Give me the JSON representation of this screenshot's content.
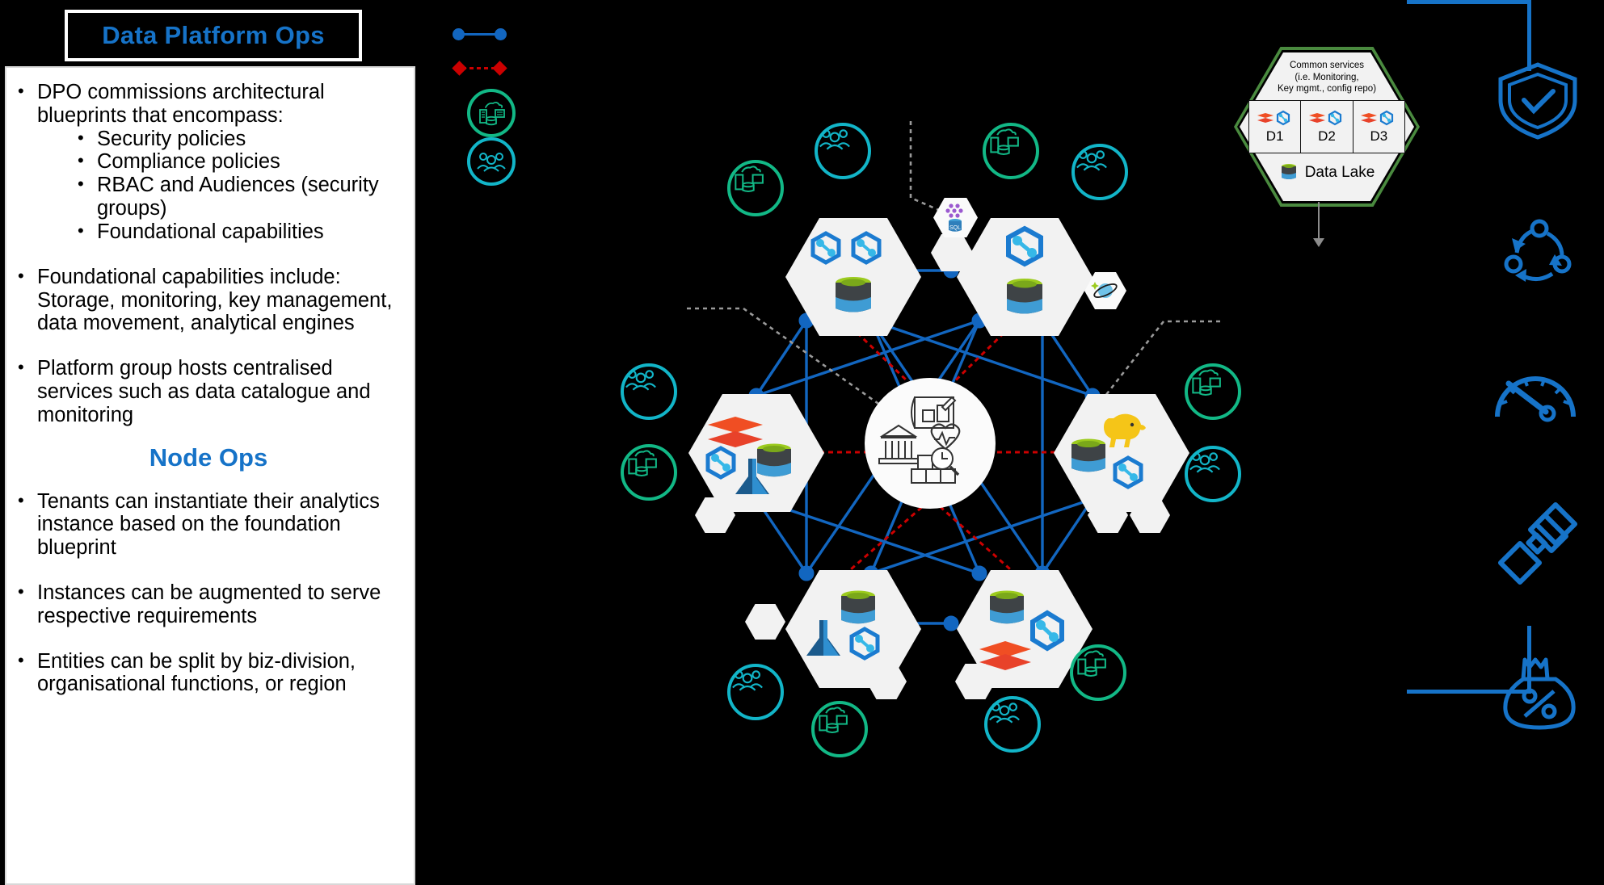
{
  "slide": {
    "background": "#000000",
    "accent": "#1673c8"
  },
  "left_panel": {
    "title": "Data Platform Ops",
    "bullets": [
      {
        "level": 1,
        "text": "DPO commissions architectural blueprints that encompass:"
      },
      {
        "level": 2,
        "text": "Security policies"
      },
      {
        "level": 2,
        "text": "Compliance policies"
      },
      {
        "level": 2,
        "text": "RBAC and Audiences (security groups)"
      },
      {
        "level": 2,
        "text": "Foundational capabilities"
      },
      {
        "level": 1,
        "text": "Foundational capabilities include: Storage, monitoring, key management, data movement, analytical engines"
      },
      {
        "level": 1,
        "text": "Platform group hosts centralised services such as data catalogue and monitoring"
      }
    ],
    "section_title": "Node Ops",
    "bullets2": [
      {
        "level": 1,
        "text": "Tenants can instantiate their analytics instance based on the foundation blueprint"
      },
      {
        "level": 1,
        "text": "Instances can be augmented to serve respective requirements"
      },
      {
        "level": 1,
        "text": "Entities can be split by biz-division, organisational functions, or region"
      }
    ]
  },
  "legend": {
    "items": [
      {
        "name": "solid-blue-link",
        "style": "solid-line",
        "color": "#1266c0",
        "endpoint": "circle"
      },
      {
        "name": "dashed-red-link",
        "style": "dashed-line",
        "color": "#cc0000",
        "endpoint": "diamond"
      },
      {
        "name": "data-sources",
        "style": "circle-icon",
        "color": "#12b886",
        "icon": "datasource-icon"
      },
      {
        "name": "people-audience",
        "style": "circle-icon",
        "color": "#12b5c8",
        "icon": "people-icon"
      }
    ]
  },
  "common_services": {
    "title_lines": [
      "Common services",
      "(i.e. Monitoring,",
      "Key mgmt., config repo)"
    ],
    "cells": [
      {
        "label": "D1",
        "icons": [
          "databricks-icon",
          "synapse-icon"
        ]
      },
      {
        "label": "D2",
        "icons": [
          "databricks-icon",
          "synapse-icon"
        ]
      },
      {
        "label": "D3",
        "icons": [
          "databricks-icon",
          "synapse-icon"
        ]
      }
    ],
    "footer": {
      "label": "Data Lake",
      "icon": "datalake-icon"
    },
    "border_color": "#4a8a3f"
  },
  "network": {
    "center": {
      "name": "governance-hub",
      "icons": [
        "blueprint-icon",
        "heartbeat-icon",
        "bank-icon",
        "catalog-search-icon"
      ]
    },
    "nodes": [
      {
        "id": "n-top-left",
        "icons": [
          "synapse-icon",
          "synapse-icon",
          "datalake-icon"
        ]
      },
      {
        "id": "n-top-right",
        "icons": [
          "synapse-icon",
          "datalake-icon"
        ],
        "satellites": [
          "sqldb-icon",
          "cosmosdb-icon"
        ]
      },
      {
        "id": "n-left",
        "icons": [
          "databricks-icon",
          "synapse-icon",
          "datalake-icon",
          "azureml-icon"
        ]
      },
      {
        "id": "n-right",
        "icons": [
          "hadoop-icon",
          "datalake-icon",
          "synapse-icon"
        ]
      },
      {
        "id": "n-bottom-left",
        "icons": [
          "datalake-icon",
          "azureml-icon",
          "synapse-icon"
        ]
      },
      {
        "id": "n-bottom-right",
        "icons": [
          "datalake-icon",
          "synapse-icon",
          "databricks-icon"
        ]
      }
    ],
    "link_colors": {
      "solid": "#1266c0",
      "dashed": "#cc0000",
      "callout": "#9a9a9a"
    }
  },
  "right_rail": {
    "icons": [
      {
        "name": "shield-check-icon",
        "meaning": "security"
      },
      {
        "name": "lifecycle-arrows-icon",
        "meaning": "data lifecycle"
      },
      {
        "name": "gauge-icon",
        "meaning": "performance"
      },
      {
        "name": "satellite-icon",
        "meaning": "monitoring"
      },
      {
        "name": "money-bag-percent-icon",
        "meaning": "cost"
      }
    ],
    "color": "#1673c8"
  }
}
